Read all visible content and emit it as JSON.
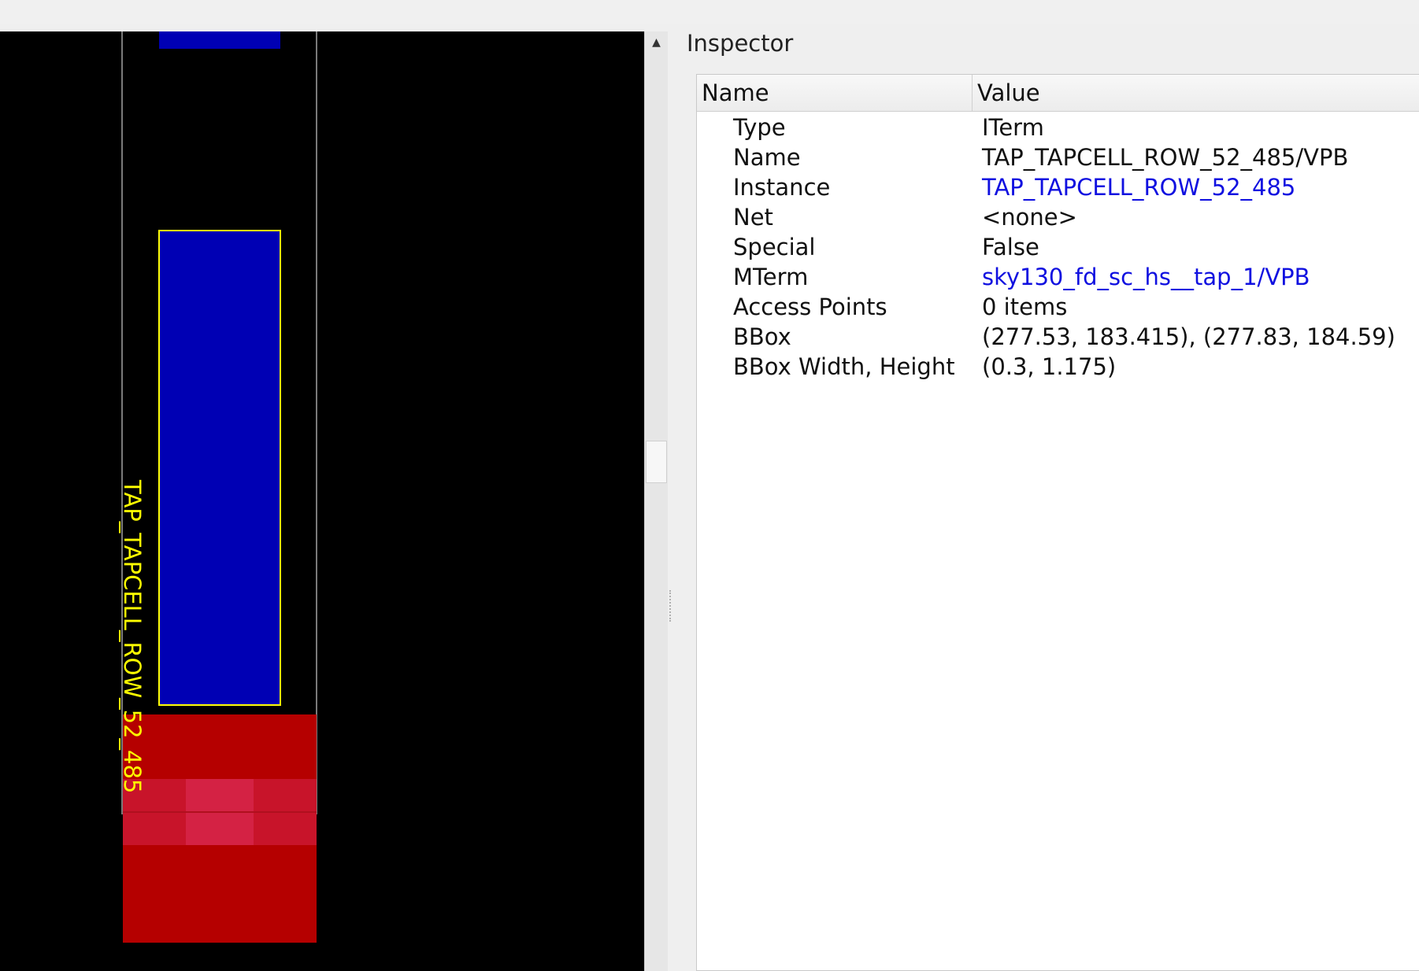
{
  "canvas": {
    "instance_label": "TAP_TAPCELL_ROW_52_485",
    "colors": {
      "background": "#000000",
      "pin_blue": "#0000b4",
      "pin_outline": "#ffff00",
      "red_region": "#b50000",
      "red_highlight": "#d0203c",
      "cell_outline": "#808080"
    }
  },
  "scrollbar": {
    "up_icon": "triangle-up-icon"
  },
  "inspector": {
    "title": "Inspector",
    "columns": {
      "name": "Name",
      "value": "Value"
    },
    "rows": [
      {
        "key": "Type",
        "value": "ITerm",
        "link": false
      },
      {
        "key": "Name",
        "value": "TAP_TAPCELL_ROW_52_485/VPB",
        "link": false
      },
      {
        "key": "Instance",
        "value": "TAP_TAPCELL_ROW_52_485",
        "link": true
      },
      {
        "key": "Net",
        "value": "<none>",
        "link": false
      },
      {
        "key": "Special",
        "value": "False",
        "link": false
      },
      {
        "key": "MTerm",
        "value": "sky130_fd_sc_hs__tap_1/VPB",
        "link": true
      },
      {
        "key": "Access Points",
        "value": "0 items",
        "link": false
      },
      {
        "key": "BBox",
        "value": "(277.53, 183.415), (277.83, 184.59)",
        "link": false
      },
      {
        "key": "BBox Width, Height",
        "value": "(0.3, 1.175)",
        "link": false
      }
    ],
    "link_color": "#1010e0"
  }
}
